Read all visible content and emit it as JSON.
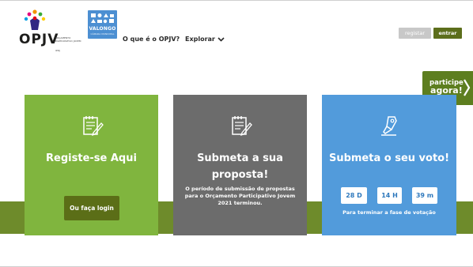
{
  "header": {
    "logo": {
      "text": "OPJV",
      "subtitle": "ORÇAMENTO PARTICIPATIVO JOVEM",
      "ipdj": "IPDJ"
    },
    "municipality_logo": {
      "name": "VALONGO",
      "tagline": "CÂMARA MUNICIPAL"
    },
    "nav": [
      {
        "label": "O que é o OPJV?"
      },
      {
        "label": "Explorar",
        "icon": "chevron-down-icon"
      }
    ],
    "buttons": {
      "register": "registar",
      "login": "entrar"
    }
  },
  "participe": {
    "line1": "participe",
    "line2": "agora!",
    "icon": "chevron-right-icon"
  },
  "cards": [
    {
      "icon": "register-form-icon",
      "title": "Registe-se Aqui",
      "button": "Ou faça login"
    },
    {
      "icon": "submit-proposal-icon",
      "title": "Submeta a sua proposta!",
      "description": "O período de submissão de propostas para o Orçamento Participativo Jovem 2021 terminou."
    },
    {
      "icon": "vote-pen-icon",
      "title": "Submeta o seu voto!",
      "countdown": {
        "days": "28 D",
        "hours": "14 H",
        "minutes": "39 m"
      },
      "caption": "Para terminar a fase de votação"
    }
  ],
  "colors": {
    "green_card": "#80b53e",
    "gray_card": "#6c6c6c",
    "blue_card": "#529bdb",
    "dark_green": "#5c6e1b",
    "band": "#6e8b2b"
  }
}
